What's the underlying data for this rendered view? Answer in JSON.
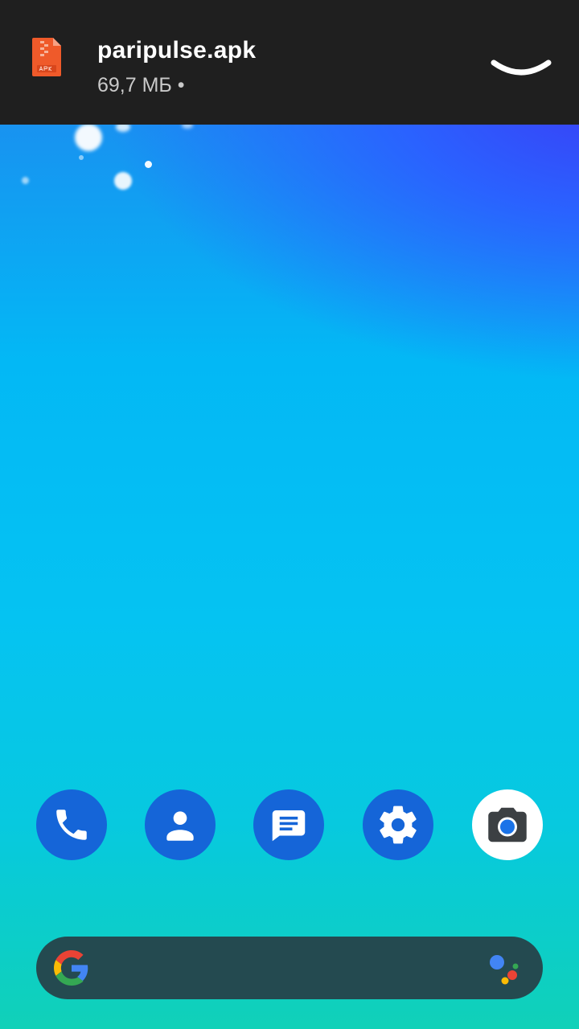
{
  "download": {
    "file_name": "paripulse.apk",
    "file_meta": "69,7 МБ •",
    "icon": "apk-file-icon",
    "collapse_icon": "chevron-down-icon"
  },
  "dock": {
    "apps": [
      {
        "name": "Phone",
        "icon": "phone-icon"
      },
      {
        "name": "Contacts",
        "icon": "contacts-icon"
      },
      {
        "name": "Messages",
        "icon": "messages-icon"
      },
      {
        "name": "Settings",
        "icon": "gear-icon"
      },
      {
        "name": "Camera",
        "icon": "camera-icon"
      }
    ]
  },
  "search": {
    "logo_icon": "google-g-icon",
    "assistant_icon": "google-assistant-icon"
  },
  "colors": {
    "bar_bg": "#1f1f1f",
    "dock_blue": "#1565d8",
    "search_bg": "#244a50"
  }
}
